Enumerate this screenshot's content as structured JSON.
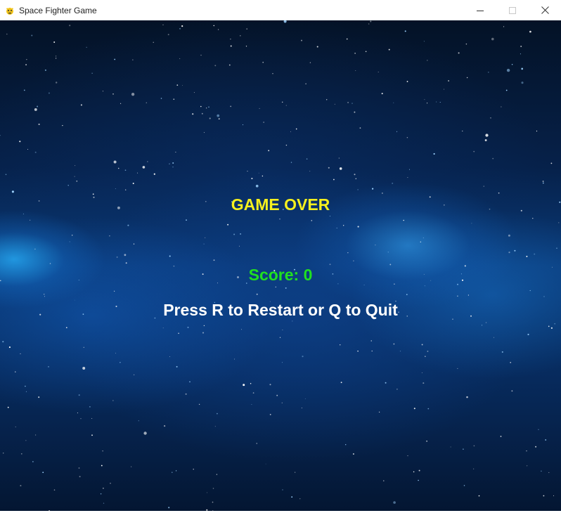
{
  "window": {
    "title": "Space Fighter Game",
    "icon": "pygame-snake-icon",
    "controls": [
      "minimize-icon",
      "maximize-icon",
      "close-icon"
    ]
  },
  "game": {
    "game_over_text": "GAME OVER",
    "score_text": "Score: 0",
    "prompt_text": "Press R to Restart or Q to Quit"
  },
  "colors": {
    "game_over": "#f5f01e",
    "score": "#20e020",
    "prompt": "#ffffff",
    "space_dark": "#041226",
    "nebula": "#1e8cff"
  }
}
